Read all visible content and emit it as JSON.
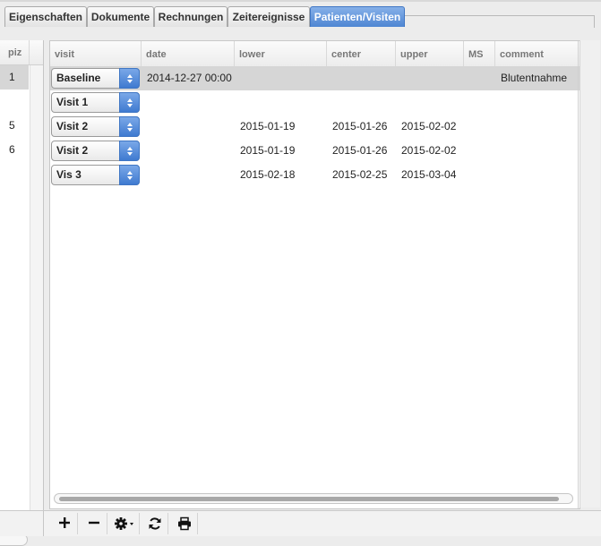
{
  "tabs": [
    {
      "label": "Eigenschaften",
      "active": false
    },
    {
      "label": "Dokumente",
      "active": false
    },
    {
      "label": "Rechnungen",
      "active": false
    },
    {
      "label": "Zeitereignisse",
      "active": false
    },
    {
      "label": "Patienten/Visiten",
      "active": true
    }
  ],
  "left_pane": {
    "header": "piz",
    "rows": [
      "1",
      "",
      "5",
      "6",
      ""
    ]
  },
  "grid": {
    "columns": [
      "visit",
      "date",
      "lower",
      "center",
      "upper",
      "MS",
      "comment"
    ],
    "rows": [
      {
        "visit": "Baseline",
        "date": "2014-12-27 00:00",
        "lower": "",
        "center": "",
        "upper": "",
        "ms": "",
        "comment": "Blutentnahme"
      },
      {
        "visit": "Visit 1",
        "date": "",
        "lower": "",
        "center": "",
        "upper": "",
        "ms": "",
        "comment": ""
      },
      {
        "visit": "Visit 2",
        "date": "",
        "lower": "2015-01-19",
        "center": "2015-01-26",
        "upper": "2015-02-02",
        "ms": "",
        "comment": ""
      },
      {
        "visit": "Visit 2",
        "date": "",
        "lower": "2015-01-19",
        "center": "2015-01-26",
        "upper": "2015-02-02",
        "ms": "",
        "comment": ""
      },
      {
        "visit": "Vis 3",
        "date": "",
        "lower": "2015-02-18",
        "center": "2015-02-25",
        "upper": "2015-03-04",
        "ms": "",
        "comment": ""
      }
    ]
  },
  "toolbar": {
    "icons": [
      "add-icon",
      "remove-icon",
      "gear-icon",
      "refresh-icon",
      "print-icon"
    ]
  },
  "colors": {
    "active_tab": "#4e86d3",
    "selected_row": "#d6d6d6",
    "select_button": "#3f7ad0"
  }
}
